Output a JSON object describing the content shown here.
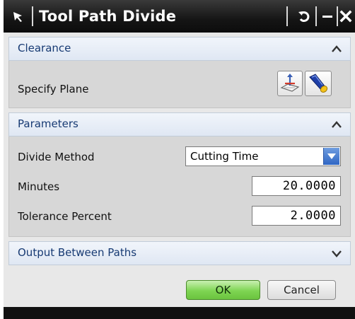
{
  "window": {
    "title": "Tool Path Divide"
  },
  "clearance": {
    "header": "Clearance",
    "specify_plane_label": "Specify Plane"
  },
  "parameters": {
    "header": "Parameters",
    "divide_method_label": "Divide Method",
    "divide_method_value": "Cutting Time",
    "minutes_label": "Minutes",
    "minutes_value": "20.0000",
    "tolerance_label": "Tolerance Percent",
    "tolerance_value": "2.0000"
  },
  "output": {
    "header": "Output Between Paths"
  },
  "buttons": {
    "ok": "OK",
    "cancel": "Cancel"
  },
  "icons": {
    "title": "selection-arrow-icon",
    "reset": "reset-icon",
    "minimize": "minimize-icon",
    "close": "close-icon",
    "plane_dialog": "plane-dialog-icon",
    "plane_list": "flashlight-icon"
  },
  "colors": {
    "titlebar": "#151515",
    "section_header_text": "#173a73",
    "ok_button": "#7ed452",
    "dropdown_arrow": "#2f66c4"
  }
}
